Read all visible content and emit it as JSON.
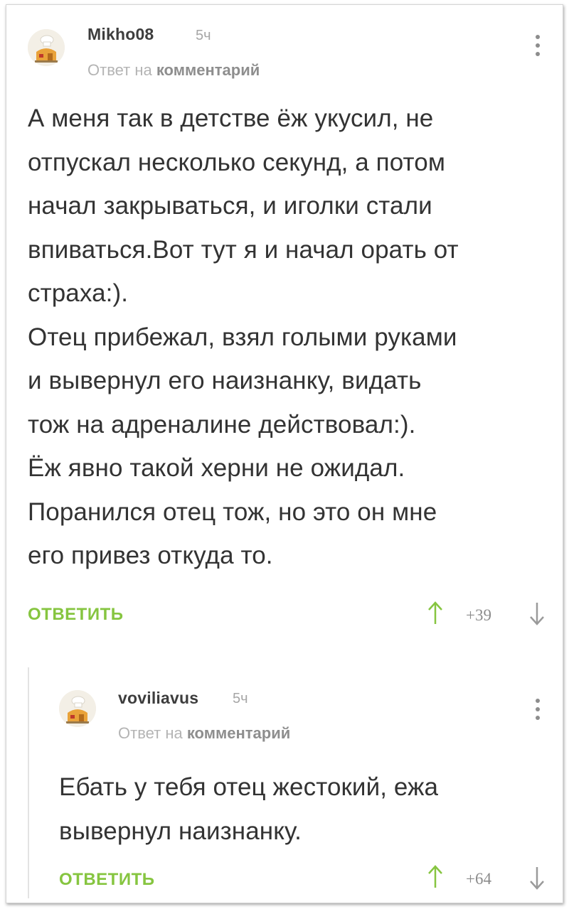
{
  "comments": [
    {
      "username": "Mikho08",
      "time": "5ч",
      "reply_prefix": "Ответ на ",
      "reply_target": "комментарий",
      "lines": [
        "А меня так в детстве ёж укусил, не",
        "отпускал несколько секунд, а потом",
        "начал закрываться, и иголки стали",
        "впиваться.Вот тут я и начал орать от",
        "страха:).",
        "Отец прибежал, взял голыми руками",
        "и вывернул его наизнанку, видать",
        "тож на адреналине действовал:).",
        "Ёж явно такой херни не ожидал.",
        "Поранился отец тож, но это он мне",
        "его привез откуда то."
      ],
      "reply_label": "ОТВЕТИТЬ",
      "score": "+39",
      "avatar_icon": "chef-hat-house-avatar-icon",
      "upvote_icon": "arrow-up-icon",
      "downvote_icon": "arrow-down-icon",
      "menu_icon": "kebab-menu-icon"
    },
    {
      "username": "voviliavus",
      "time": "5ч",
      "reply_prefix": "Ответ на ",
      "reply_target": "комментарий",
      "lines": [
        "Ебать у тебя отец жестокий, ежа",
        "вывернул наизнанку."
      ],
      "reply_label": "ОТВЕТИТЬ",
      "score": "+64",
      "avatar_icon": "chef-hat-house-avatar-icon",
      "upvote_icon": "arrow-up-icon",
      "downvote_icon": "arrow-down-icon",
      "menu_icon": "kebab-menu-icon"
    }
  ],
  "colors": {
    "accent_green": "#86c540",
    "text": "#333333",
    "meta_gray": "#b4b4b4",
    "border": "#d4d4d4"
  }
}
